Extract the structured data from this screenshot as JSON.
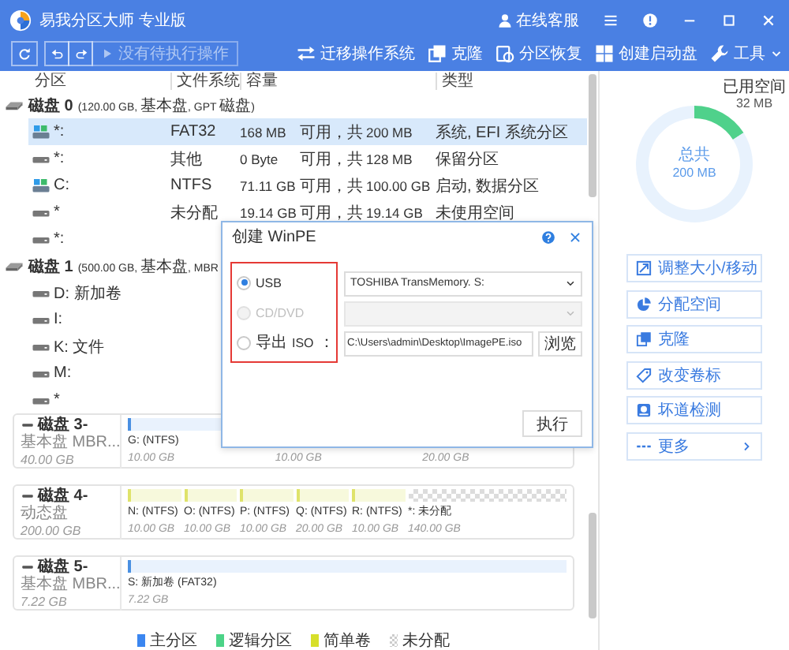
{
  "window": {
    "title": "易我分区大师 专业版",
    "support": "在线客服"
  },
  "toolbar": {
    "pending": {
      "label": "没有待执行操作",
      "disabled": true
    },
    "actions": [
      {
        "label": "迁移操作系统",
        "menu": false
      },
      {
        "label": "克隆",
        "menu": false
      },
      {
        "label": "分区恢复",
        "menu": false
      },
      {
        "label": "创建启动盘",
        "menu": false
      },
      {
        "label": "工具",
        "menu": true
      }
    ]
  },
  "partition_table": {
    "columns": [
      "分区",
      "文件系统",
      "容量",
      "类型"
    ],
    "disks": [
      {
        "name": "磁盘 0",
        "details": "(120.00 GB, 基本盘, GPT 磁盘)",
        "partitions": [
          {
            "name": "*:",
            "kind": "system",
            "selected": true,
            "fs": "FAT32",
            "free": "168 MB",
            "free_label": "可用，共",
            "total": "200 MB",
            "type": "系统, EFI 系统分区"
          },
          {
            "name": "*:",
            "kind": "drive",
            "selected": false,
            "fs": "其他",
            "free": "0 Byte",
            "free_label": "可用，共",
            "total": "128 MB",
            "type": "保留分区"
          },
          {
            "name": "C:",
            "kind": "system",
            "selected": false,
            "fs": "NTFS",
            "free": "71.11 GB",
            "free_label": "可用，共",
            "total": "100.00 GB",
            "type": "启动, 数据分区"
          },
          {
            "name": "*",
            "kind": "drive",
            "selected": false,
            "fs": "未分配",
            "free": "19.14 GB",
            "free_label": "可用，共",
            "total": "19.14 GB",
            "type": "未使用空间"
          },
          {
            "name": "*:",
            "kind": "drive",
            "selected": false
          }
        ]
      },
      {
        "name": "磁盘 1",
        "details": "(500.00 GB, 基本盘, MBR",
        "partitions": [
          {
            "name": "D: 新加卷",
            "kind": "drive",
            "selected": false
          },
          {
            "name": "I:",
            "kind": "drive",
            "selected": false
          },
          {
            "name": "K: 文件",
            "kind": "drive",
            "selected": false
          },
          {
            "name": "M:",
            "kind": "drive",
            "selected": false
          },
          {
            "name": "*",
            "kind": "drive",
            "selected": false
          }
        ]
      }
    ]
  },
  "disk_map": {
    "disks": [
      {
        "name": "磁盘 3-",
        "type": "基本盘 MBR...",
        "size": "40.00 GB",
        "partitions": [
          {
            "kind": "primary",
            "label": "G: (NTFS)",
            "size": "10.00 GB"
          },
          {
            "size": "10.00 GB"
          },
          {
            "size": "20.00 GB"
          }
        ]
      },
      {
        "name": "磁盘 4-",
        "type": "动态盘",
        "size": "200.00 GB",
        "partitions": [
          {
            "kind": "simple",
            "label": "N: (NTFS)",
            "size": "10.00 GB"
          },
          {
            "kind": "simple",
            "label": "O: (NTFS)",
            "size": "10.00 GB"
          },
          {
            "kind": "simple",
            "label": "P: (NTFS)",
            "size": "10.00 GB"
          },
          {
            "kind": "simple",
            "label": "Q: (NTFS)",
            "size": "20.00 GB"
          },
          {
            "kind": "simple",
            "label": "R: (NTFS)",
            "size": "10.00 GB"
          },
          {
            "kind": "unallocated",
            "label": "*: 未分配",
            "size": "140.00 GB"
          }
        ]
      },
      {
        "name": "磁盘 5-",
        "type": "基本盘 MBR...",
        "size": "7.22 GB",
        "partitions": [
          {
            "kind": "primary",
            "label": "S: 新加卷 (FAT32)",
            "size": "7.22 GB"
          }
        ]
      }
    ],
    "legend": [
      {
        "kind": "primary",
        "label": "主分区"
      },
      {
        "kind": "logical",
        "label": "逻辑分区"
      },
      {
        "kind": "simple",
        "label": "简单卷"
      },
      {
        "kind": "unallocated",
        "label": "未分配"
      }
    ]
  },
  "usage": {
    "used_label": "已用空间",
    "used": "32 MB",
    "total_label": "总共",
    "total": "200 MB",
    "chart_data": {
      "type": "donut",
      "values": [
        16,
        84
      ]
    }
  },
  "side_actions": [
    {
      "kind": "action",
      "label": "调整大小/移动"
    },
    {
      "kind": "action",
      "label": "分配空间"
    },
    {
      "kind": "action",
      "label": "克隆"
    },
    {
      "kind": "action",
      "label": "改变卷标"
    },
    {
      "kind": "action",
      "label": "坏道检测"
    },
    {
      "kind": "more",
      "label": "更多"
    }
  ],
  "dialog": {
    "title": "创建 WinPE",
    "options": [
      {
        "label": "USB",
        "selected": true,
        "disabled": false,
        "field": {
          "kind": "select",
          "value": "TOSHIBA TransMemory. S:",
          "disabled": false
        }
      },
      {
        "label": "CD/DVD",
        "selected": false,
        "disabled": true,
        "field": {
          "kind": "select",
          "disabled": true
        }
      },
      {
        "label": "导出 ISO：",
        "selected": false,
        "disabled": false,
        "field": {
          "kind": "file",
          "value": "C:\\Users\\admin\\Desktop\\ImagePE.iso",
          "button": "浏览"
        }
      }
    ],
    "execute": "执行"
  }
}
